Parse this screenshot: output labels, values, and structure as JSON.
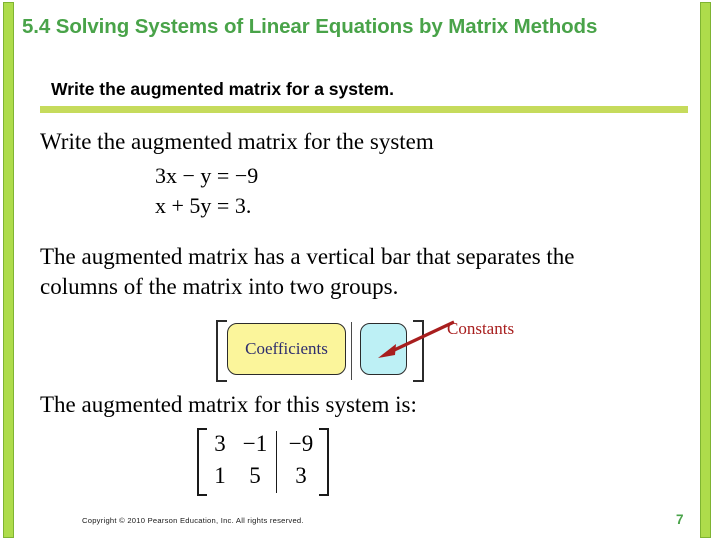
{
  "slide": {
    "title": "5.4 Solving Systems of Linear Equations by Matrix Methods",
    "objective": "Write the augmented matrix for a system.",
    "page_number": "7",
    "copyright": "Copyright © 2010 Pearson Education, Inc.  All rights reserved.",
    "accent_color": "#49A349",
    "bar_color": "#AEDC4B",
    "rule_color": "#C6DB5C"
  },
  "body": {
    "intro": "Write the augmented matrix for the system",
    "equations": [
      {
        "lhs_a": "3",
        "var1": "x",
        "op": " − ",
        "var2": "y",
        "eq": " = ",
        "rhs": "−9"
      },
      {
        "lhs_a": "",
        "var1": "x",
        "op": " + ",
        "coef2": "5",
        "var2": "y",
        "eq": " = ",
        "rhs": "3."
      }
    ],
    "equation_lines": [
      "3x − y = −9",
      "x + 5y = 3."
    ],
    "explanation_line_1": "The augmented matrix has a vertical bar that separates the",
    "explanation_line_2": "columns of the matrix into two groups.",
    "result_line": "The augmented matrix for this system is:"
  },
  "schematic": {
    "coefficients_label": "Coefficients",
    "coefficients_fill": "#FBF59B",
    "coefficients_text_color": "#2E2E6E",
    "constants_fill": "#BDF0F5",
    "constants_label": "Constants",
    "constants_label_color": "#A81E1E",
    "arrow_color": "#A81E1E"
  },
  "final_matrix": {
    "rows": [
      [
        "3",
        "−1",
        "−9"
      ],
      [
        "1",
        "5",
        "3"
      ]
    ],
    "divider_after_column": 2
  }
}
